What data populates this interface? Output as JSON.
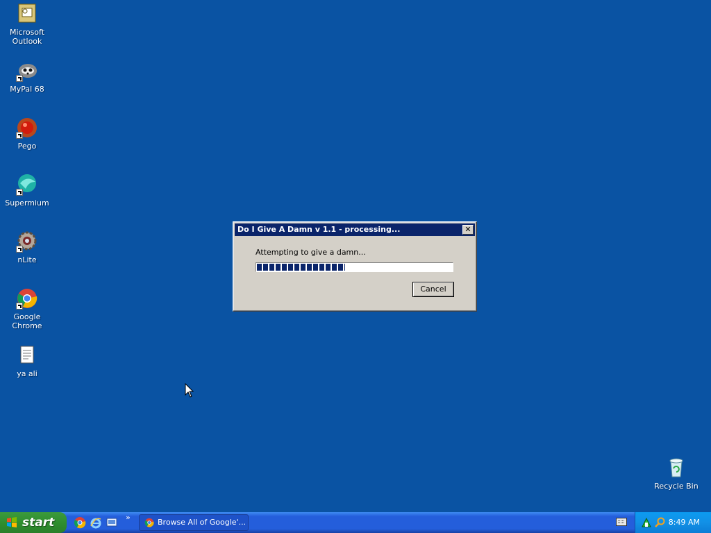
{
  "desktop": {
    "icons": [
      {
        "label": "Microsoft\nOutlook",
        "icon": "outlook-icon"
      },
      {
        "label": "MyPal 68",
        "icon": "mypal-icon"
      },
      {
        "label": "Pego",
        "icon": "pego-icon"
      },
      {
        "label": "Supermium",
        "icon": "supermium-icon"
      },
      {
        "label": "nLite",
        "icon": "nlite-icon"
      },
      {
        "label": "Google Chrome",
        "icon": "chrome-icon"
      },
      {
        "label": "ya ali",
        "icon": "text-document-icon"
      },
      {
        "label": "Recycle Bin",
        "icon": "recycle-bin-icon"
      }
    ],
    "background_color": "#0a53a3"
  },
  "dialog": {
    "title": "Do I Give A Damn v 1.1 - processing...",
    "message": "Attempting to give a damn...",
    "progress_fraction": 0.45,
    "cancel_label": "Cancel",
    "close_glyph": "✕"
  },
  "taskbar": {
    "start_label": "start",
    "quick_launch": [
      "chrome-icon",
      "internet-explorer-icon",
      "show-desktop-icon"
    ],
    "quick_launch_more": "»",
    "task_button_label": "Browse All of Google'...",
    "clock": "8:49 AM"
  }
}
